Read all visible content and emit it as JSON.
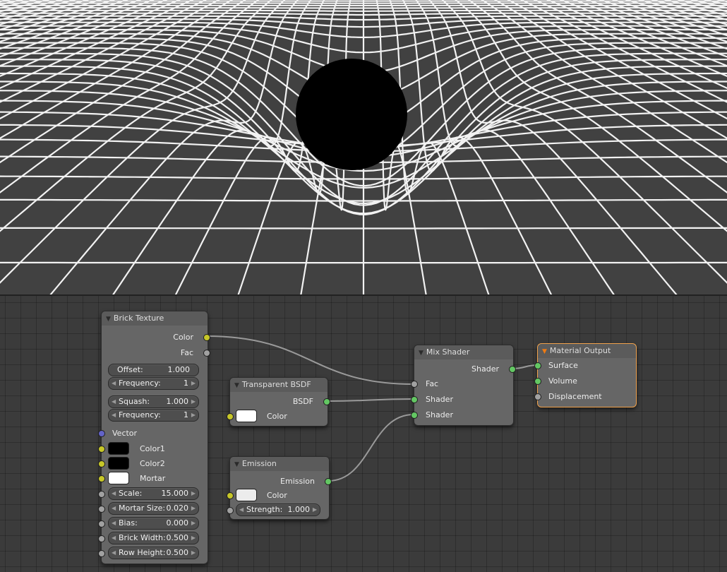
{
  "colors": {
    "viewport_bg": "#414141",
    "grid_bg": "#3b3b3b",
    "node_bg": "#666666",
    "active_border": "#f0a14b",
    "socket_color": "#c7c729",
    "socket_float": "#a1a1a1",
    "socket_shader": "#63c763",
    "socket_vector": "#6363c7",
    "swatch_black": "#000000",
    "swatch_white": "#ffffff"
  },
  "viewport": {
    "description_icon": "render-view"
  },
  "nodes": {
    "brick": {
      "title": "Brick Texture",
      "outputs": {
        "color": "Color",
        "fac": "Fac"
      },
      "offset": {
        "label": "Offset:",
        "value": "1.000"
      },
      "frequency1": {
        "label": "Frequency:",
        "value": "1"
      },
      "squash": {
        "label": "Squash:",
        "value": "1.000"
      },
      "frequency2": {
        "label": "Frequency:",
        "value": "1"
      },
      "inputs": {
        "vector": "Vector",
        "color1": "Color1",
        "color2": "Color2",
        "mortar": "Mortar"
      },
      "scale": {
        "label": "Scale:",
        "value": "15.000"
      },
      "mortar_size": {
        "label": "Mortar Size:",
        "value": "0.020"
      },
      "bias": {
        "label": "Bias:",
        "value": "0.000"
      },
      "brick_width": {
        "label": "Brick Width:",
        "value": "0.500"
      },
      "row_height": {
        "label": "Row Height:",
        "value": "0.500"
      }
    },
    "transparent": {
      "title": "Transparent BSDF",
      "output": "BSDF",
      "color_label": "Color"
    },
    "emission": {
      "title": "Emission",
      "output": "Emission",
      "color_label": "Color",
      "strength": {
        "label": "Strength:",
        "value": "1.000"
      }
    },
    "mix": {
      "title": "Mix Shader",
      "output": "Shader",
      "fac": "Fac",
      "shader1": "Shader",
      "shader2": "Shader"
    },
    "output": {
      "title": "Material Output",
      "surface": "Surface",
      "volume": "Volume",
      "displacement": "Displacement"
    }
  }
}
